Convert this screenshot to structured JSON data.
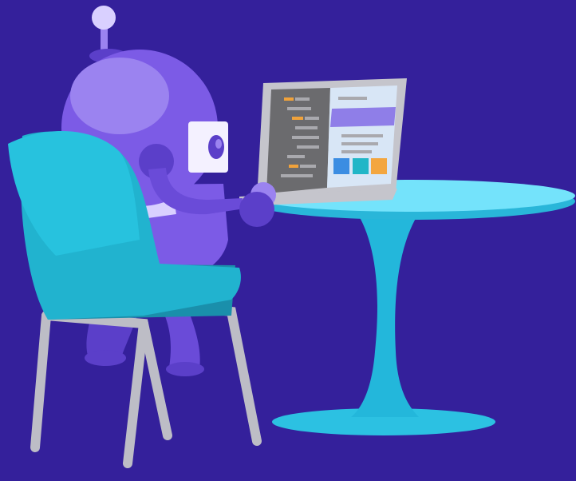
{
  "scene": {
    "colors": {
      "background": "#34209b",
      "robot_body": "#7c5be6",
      "robot_body_light": "#9b83f0",
      "robot_body_dark": "#5b3fc9",
      "robot_body_shadow": "#6a4bd8",
      "robot_face": "#f4f1ff",
      "robot_eye": "#5b3fc9",
      "robot_stripe": "#d9d0ff",
      "chair_seat": "#21b3cf",
      "chair_back": "#27c2de",
      "chair_shadow": "#1a8fab",
      "chair_legs": "#bdbdc6",
      "table_top": "#74e3fb",
      "table_top_edge": "#29b6d9",
      "table_stem": "#23b7db",
      "table_base": "#2cc1e2",
      "laptop_body": "#c5c5cc",
      "laptop_screen_left": "#6b6b6e",
      "laptop_screen_right": "#d8e6f6",
      "laptop_header": "#8f7ee8",
      "code_line_gray": "#a9a9ae",
      "code_line_orange": "#f0a23b",
      "tile_blue": "#3b8de2",
      "tile_teal": "#21b6c7",
      "tile_orange": "#f3a63f"
    }
  }
}
